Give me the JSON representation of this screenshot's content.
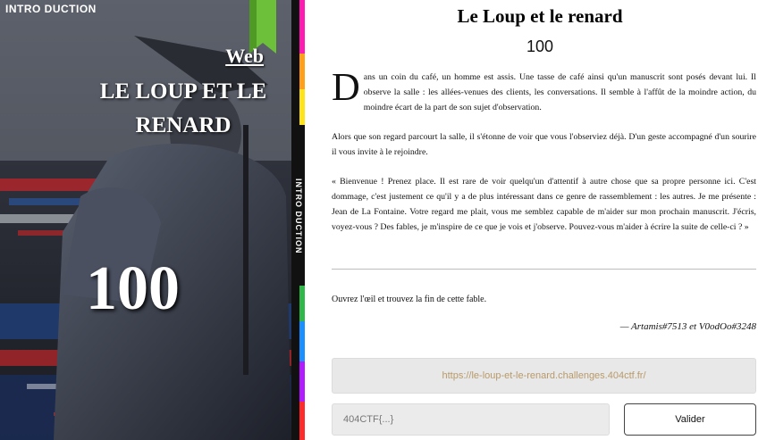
{
  "cover": {
    "category": "INTRO DUCTION",
    "kicker": "Web",
    "title": "LE LOUP ET LE RENARD",
    "points": "100",
    "spine_text": "INTRO DUCTION",
    "colors": {
      "bookmark": "#6cc03a",
      "spine_strip": [
        "#ff2a2a",
        "#ff9f1a",
        "#ffe31a",
        "#2fb74a",
        "#1a8fff",
        "#b21aff",
        "#ff1ab2"
      ]
    }
  },
  "challenge": {
    "title": "Le Loup et le renard",
    "points": "100",
    "dropcap": "D",
    "paragraphs": [
      "ans un coin du café, un homme est assis. Une tasse de café ainsi qu'un manuscrit sont posés devant lui. Il observe la salle : les allées-venues des clients, les conversations. Il semble à l'affût de la moindre action, du moindre écart de la part de son sujet d'observation.",
      "Alors que son regard parcourt la salle, il s'étonne de voir que vous l'observiez déjà. D'un geste accompagné d'un sourire il vous invite à le rejoindre.",
      "« Bienvenue ! Prenez place. Il est rare de voir quelqu'un d'attentif à autre chose que sa propre personne ici. C'est dommage, c'est justement ce qu'il y a de plus intéressant dans ce genre de rassemblement : les autres. Je me présente : Jean de La Fontaine. Votre regard me plait, vous me semblez capable de m'aider sur mon prochain manuscrit. J'écris, voyez-vous ? Des fables, je m'inspire de ce que je vois et j'observe. Pouvez-vous m'aider à écrire la suite de celle-ci ? »"
    ],
    "prompt": "Ouvrez l'œil et trouvez la fin de cette fable.",
    "credits": "— Artamis#7513 et V0odOo#3248",
    "url": "https://le-loup-et-le-renard.challenges.404ctf.fr/",
    "flag_placeholder": "404CTF{...}",
    "submit_label": "Valider"
  }
}
